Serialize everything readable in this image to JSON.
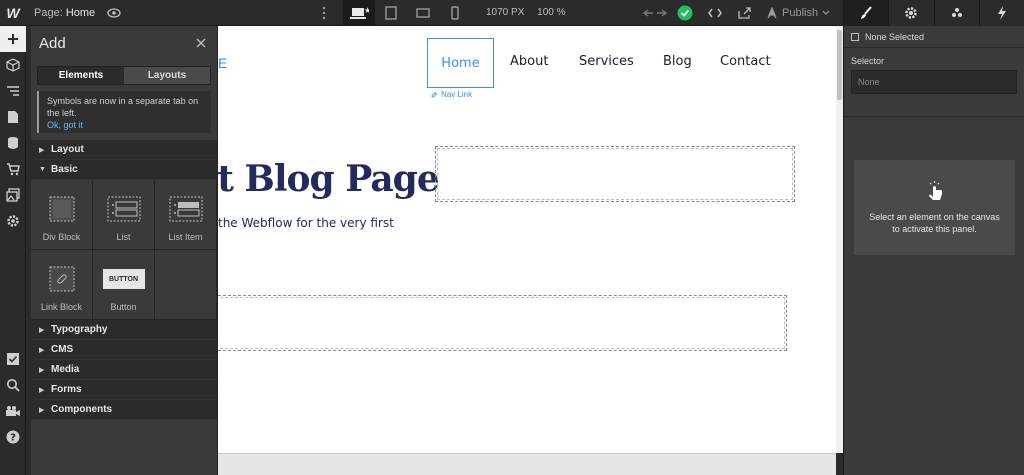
{
  "topbar": {
    "logo": "W",
    "page_prefix": "Page:",
    "page_name": "Home",
    "width_value": "1070 PX",
    "zoom_value": "100 %",
    "publish_label": "Publish"
  },
  "add_panel": {
    "title": "Add",
    "tabs": [
      "Elements",
      "Layouts"
    ],
    "notice_text": "Symbols are now in a separate tab on the left.",
    "notice_link": "Ok, got it",
    "sections_top": [
      "Layout",
      "Basic"
    ],
    "basic_items": [
      "Div Block",
      "List",
      "List Item",
      "Link Block",
      "Button"
    ],
    "button_preview": "BUTTON",
    "sections_bottom": [
      "Typography",
      "CMS",
      "Media",
      "Forms",
      "Components"
    ]
  },
  "canvas": {
    "nav_items": [
      "Home",
      "About",
      "Services",
      "Blog",
      "Contact"
    ],
    "nav_badge": "Nav Link",
    "brand_fragment": "E",
    "hero_title": "st Blog Page",
    "hero_sub": "the Webflow for the very first"
  },
  "right_panel": {
    "none_selected": "None Selected",
    "selector_label": "Selector",
    "selector_placeholder": "None",
    "activate_text": "Select an element on the canvas to activate this panel."
  },
  "colors": {
    "accent": "#3b8fea",
    "heading": "#222a5e",
    "success": "#1fbf5f"
  }
}
